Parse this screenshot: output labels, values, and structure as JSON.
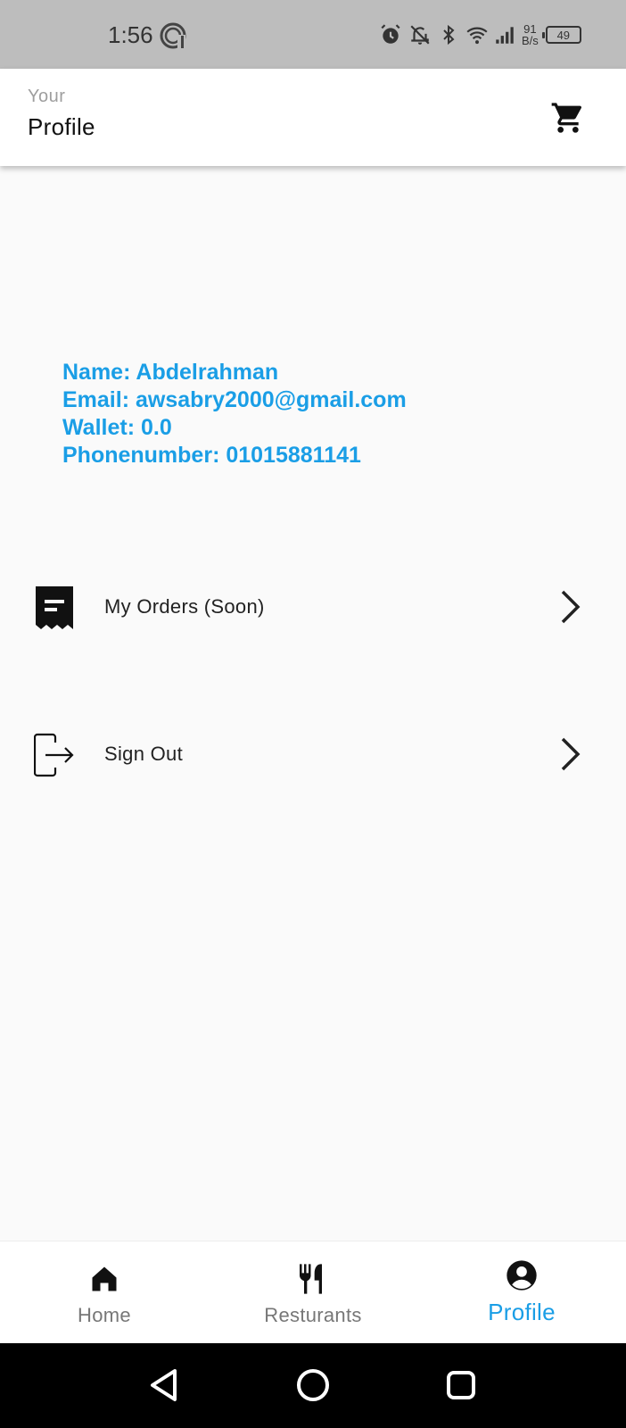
{
  "status_bar": {
    "time": "1:56",
    "net_speed_value": "91",
    "net_speed_unit": "B/s",
    "battery": "49",
    "icons": [
      "app-logo-icon",
      "alarm-icon",
      "bell-off-icon",
      "bluetooth-icon",
      "wifi-icon",
      "signal-icon",
      "battery-icon"
    ]
  },
  "app_bar": {
    "subtitle": "Your",
    "title": "Profile",
    "cart_icon": "cart-icon"
  },
  "profile": {
    "name": "Name: Abdelrahman",
    "email": "Email: awsabry2000@gmail.com",
    "wallet": "Wallet: 0.0",
    "phone": "Phonenumber: 01015881141"
  },
  "menu": {
    "items": [
      {
        "label": "My Orders (Soon)",
        "icon": "receipt-icon"
      },
      {
        "label": "Sign Out",
        "icon": "logout-icon"
      }
    ]
  },
  "bottom_nav": {
    "items": [
      {
        "label": "Home",
        "icon": "home-icon",
        "active": false
      },
      {
        "label": "Resturants",
        "icon": "restaurant-icon",
        "active": false
      },
      {
        "label": "Profile",
        "icon": "account-circle-icon",
        "active": true
      }
    ]
  },
  "colors": {
    "accent": "#1a9ee6",
    "status_bar_bg": "#bdbdbd",
    "page_bg": "#fafafa",
    "system_nav_bg": "#000000"
  }
}
